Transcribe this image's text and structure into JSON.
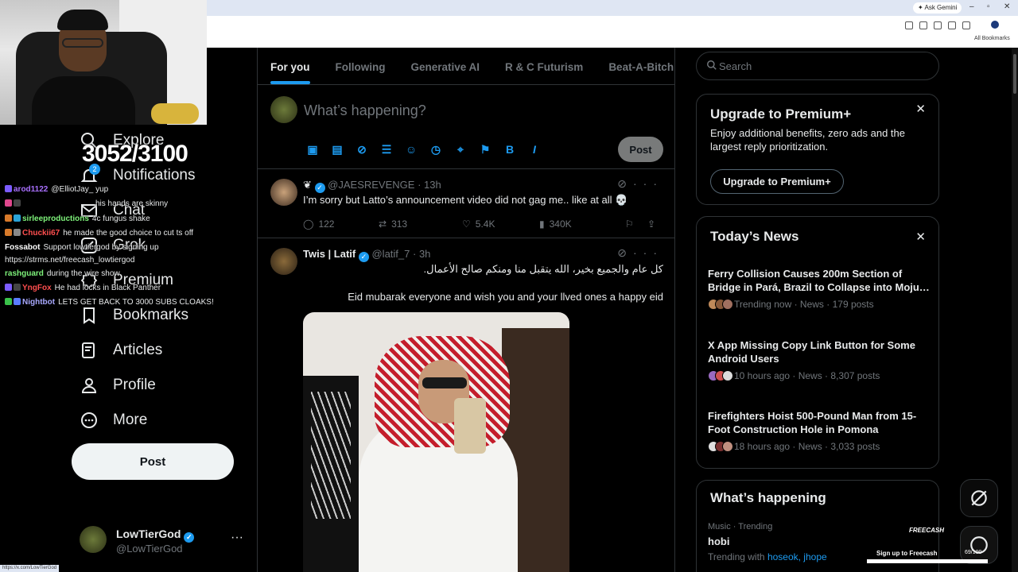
{
  "browser": {
    "ask_gemini": "✦ Ask Gemini",
    "all_bookmarks": "All Bookmarks",
    "url_tooltip": "https://x.com/LowTierGod"
  },
  "overlay": {
    "sub_count": "3052/3100"
  },
  "nav": {
    "items": [
      {
        "label": "Explore",
        "icon": "search-icon"
      },
      {
        "label": "Notifications",
        "icon": "bell-icon",
        "badge": "2"
      },
      {
        "label": "Chat",
        "icon": "mail-icon"
      },
      {
        "label": "Grok",
        "icon": "grok-icon"
      },
      {
        "label": "Premium",
        "icon": "x-premium-icon"
      },
      {
        "label": "Bookmarks",
        "icon": "bookmark-icon"
      },
      {
        "label": "Articles",
        "icon": "article-icon"
      },
      {
        "label": "Profile",
        "icon": "person-icon"
      },
      {
        "label": "More",
        "icon": "more-circle-icon"
      }
    ],
    "post_label": "Post",
    "account": {
      "name": "LowTierGod",
      "handle": "@LowTierGod",
      "more": "···"
    }
  },
  "chat": [
    {
      "user": "arod1122",
      "color": "#a970ff",
      "message": "@ElliotJay_ yup"
    },
    {
      "user": "",
      "color": "#e05a5a",
      "message": "his hands are skinny"
    },
    {
      "user": "sirleeproductions",
      "color": "#7ef27a",
      "message": "4c fungus shake"
    },
    {
      "user": "Chuckii67",
      "color": "#ff4f4f",
      "message": "he made the good choice to cut ts off"
    },
    {
      "user": "Fossabot",
      "color": "#ffffff",
      "message": "Support lowtiergod by signing up https://strms.net/freecash_lowtiergod"
    },
    {
      "user": "rashguard",
      "color": "#7ef27a",
      "message": "during the wire show"
    },
    {
      "user": "YngFox",
      "color": "#ff4f4f",
      "message": "He had locks in Black Panther"
    },
    {
      "user": "Nightbot",
      "color": "#a9a9ff",
      "message": "LETS GET BACK TO 3000 SUBS CLOAKS!"
    }
  ],
  "feed": {
    "tabs": [
      "For you",
      "Following",
      "Generative AI",
      "R & C Futurism",
      "Beat-A-Bitch"
    ],
    "compose_placeholder": "What’s happening?",
    "post_label": "Post",
    "tweets": [
      {
        "name": "",
        "handle": "@JAESREVENGE",
        "time": "· 13h",
        "text": "I’m sorry but Latto’s announcement video did not gag me.. like at all 💀",
        "replies": "122",
        "reposts": "313",
        "likes": "5.4K",
        "views": "340K"
      },
      {
        "name": "Twis | Latif",
        "handle": "@latif_7",
        "time": "· 3h",
        "text_ar": "كل عام والجميع بخير، الله يتقبل منا ومنكم صالح الأعمال.",
        "text": "Eid mubarak everyone and wish you and your llved ones a happy eid"
      }
    ]
  },
  "sidebar": {
    "search_placeholder": "Search",
    "premium": {
      "title": "Upgrade to Premium+",
      "description": "Enjoy additional benefits, zero ads and the largest reply prioritization.",
      "button": "Upgrade to Premium+"
    },
    "news": {
      "title": "Today’s News",
      "items": [
        {
          "headline": "Ferry Collision Causes 200m Section of Bridge in Pará, Brazil to Collapse into Moju…",
          "meta": "Trending now · News · 179 posts"
        },
        {
          "headline": "X App Missing Copy Link Button for Some Android Users",
          "meta": "10 hours ago · News · 8,307 posts"
        },
        {
          "headline": "Firefighters Hoist 500-Pound Man from 15-Foot Construction Hole in Pomona",
          "meta": "18 hours ago · News · 3,033 posts"
        }
      ]
    },
    "happening": {
      "title": "What’s happening",
      "category": "Music · Trending",
      "name": "hobi",
      "with_label": "Trending with",
      "with_tags": "hoseok, jhope"
    }
  },
  "freecash": {
    "logo": "FREECASH",
    "cta": "Sign up to Freecash",
    "count": "69/100"
  },
  "colors": {
    "accent": "#1d9bf0",
    "border": "#2f3336",
    "muted": "#71767b"
  }
}
